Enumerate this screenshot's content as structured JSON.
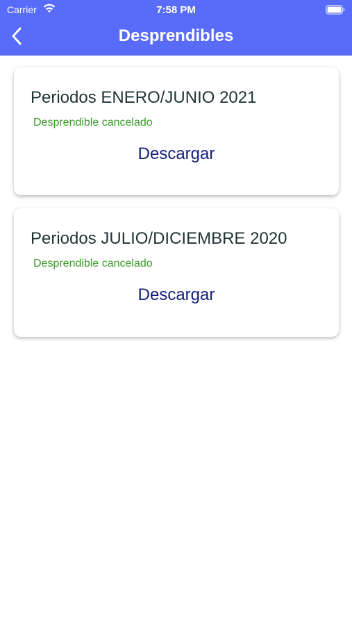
{
  "status_bar": {
    "carrier": "Carrier",
    "time": "7:58 PM",
    "wifi_icon": "wifi-icon",
    "battery_icon": "battery-icon"
  },
  "nav": {
    "title": "Desprendibles",
    "back_icon": "chevron-left-icon",
    "color": "#586cf9"
  },
  "cards": [
    {
      "title": "Periodos ENERO/JUNIO 2021",
      "status": "Desprendible cancelado",
      "action": "Descargar"
    },
    {
      "title": "Periodos JULIO/DICIEMBRE 2020",
      "status": "Desprendible cancelado",
      "action": "Descargar"
    }
  ],
  "colors": {
    "status_text": "#3a9a2a",
    "action_text": "#13207a",
    "title_text": "#1f3336"
  }
}
